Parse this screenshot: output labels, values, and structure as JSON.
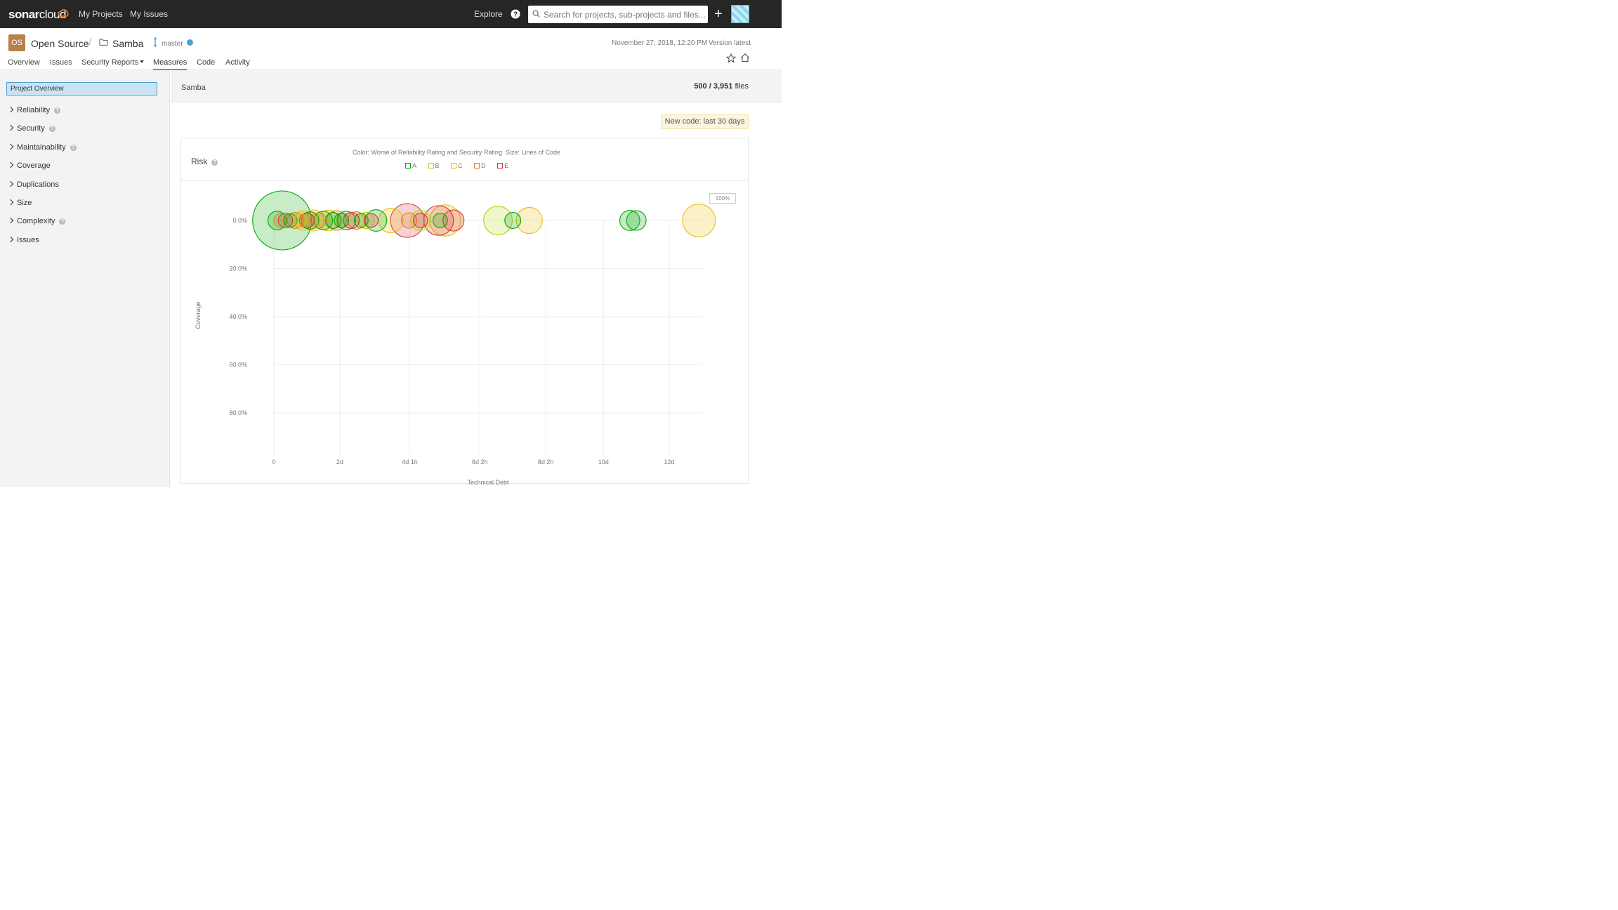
{
  "topbar": {
    "logo_text": "sonar",
    "logo_text_2": "cloud",
    "nav": [
      "My Projects",
      "My Issues"
    ],
    "explore": "Explore",
    "search_placeholder": "Search for projects, sub-projects and files...",
    "plus": "+"
  },
  "project": {
    "org_badge": "OS",
    "org_name": "Open Source",
    "name": "Samba",
    "branch": "master",
    "analysis_date": "November 27, 2018, 12:20 PM",
    "version": "Version latest",
    "tabs": [
      "Overview",
      "Issues",
      "Security Reports",
      "Measures",
      "Code",
      "Activity"
    ],
    "active_tab": "Measures"
  },
  "sidebar": {
    "overview": "Project Overview",
    "items": [
      {
        "label": "Reliability",
        "help": true
      },
      {
        "label": "Security",
        "help": true
      },
      {
        "label": "Maintainability",
        "help": true
      },
      {
        "label": "Coverage",
        "help": false
      },
      {
        "label": "Duplications",
        "help": false
      },
      {
        "label": "Size",
        "help": false
      },
      {
        "label": "Complexity",
        "help": true
      },
      {
        "label": "Issues",
        "help": false
      }
    ]
  },
  "main": {
    "component": "Samba",
    "files_shown": "500 / 3,951",
    "files_unit": "files",
    "new_code": "New code: last 30 days",
    "zoom": "100%"
  },
  "colors": {
    "A": "#00aa00",
    "B": "#b0d513",
    "C": "#eabe06",
    "D": "#ed7d20",
    "E": "#d4333f"
  },
  "chart_data": {
    "type": "scatter",
    "title": "Risk",
    "color_desc": "Color: Worse of Reliability Rating and Security Rating",
    "size_desc": "Size: Lines of Code",
    "legend": [
      "A",
      "B",
      "C",
      "D",
      "E"
    ],
    "xlabel": "Technical Debt",
    "ylabel": "Coverage",
    "x_unit": "days",
    "x_ticks": [
      {
        "value": 0,
        "label": "0"
      },
      {
        "value": 2,
        "label": "2d"
      },
      {
        "value": 4.125,
        "label": "4d 1h"
      },
      {
        "value": 6.25,
        "label": "6d 2h"
      },
      {
        "value": 8.25,
        "label": "8d 2h"
      },
      {
        "value": 10,
        "label": "10d"
      },
      {
        "value": 12,
        "label": "12d"
      }
    ],
    "xlim": [
      0,
      13
    ],
    "y_ticks": [
      0,
      20,
      40,
      60,
      80
    ],
    "y_tick_labels": [
      "0.0%",
      "20.0%",
      "40.0%",
      "60.0%",
      "80.0%"
    ],
    "ylim": [
      0,
      100
    ],
    "points": [
      {
        "x": 0.25,
        "y": 0,
        "size": 10,
        "rating": "A"
      },
      {
        "x": 0.1,
        "y": 0,
        "size": 2,
        "rating": "A"
      },
      {
        "x": 0.2,
        "y": 0,
        "size": 1,
        "rating": "D"
      },
      {
        "x": 0.35,
        "y": 0,
        "size": 1.2,
        "rating": "E"
      },
      {
        "x": 0.5,
        "y": 0,
        "size": 1,
        "rating": "A"
      },
      {
        "x": 0.65,
        "y": 0,
        "size": 1.5,
        "rating": "D"
      },
      {
        "x": 0.8,
        "y": 0,
        "size": 1,
        "rating": "C"
      },
      {
        "x": 0.9,
        "y": 0,
        "size": 2.2,
        "rating": "C"
      },
      {
        "x": 1.0,
        "y": 0,
        "size": 1.3,
        "rating": "E"
      },
      {
        "x": 1.1,
        "y": 0,
        "size": 1.8,
        "rating": "A"
      },
      {
        "x": 1.2,
        "y": 0,
        "size": 2.5,
        "rating": "C"
      },
      {
        "x": 1.35,
        "y": 0,
        "size": 1.4,
        "rating": "D"
      },
      {
        "x": 1.5,
        "y": 0,
        "size": 2,
        "rating": "A"
      },
      {
        "x": 1.65,
        "y": 0,
        "size": 2.4,
        "rating": "C"
      },
      {
        "x": 1.8,
        "y": 0,
        "size": 1.5,
        "rating": "A"
      },
      {
        "x": 1.9,
        "y": 0,
        "size": 2.2,
        "rating": "D"
      },
      {
        "x": 2.05,
        "y": 0,
        "size": 1.2,
        "rating": "A"
      },
      {
        "x": 2.2,
        "y": 0,
        "size": 2,
        "rating": "A"
      },
      {
        "x": 2.35,
        "y": 0,
        "size": 1.5,
        "rating": "E"
      },
      {
        "x": 2.5,
        "y": 0,
        "size": 1.8,
        "rating": "D"
      },
      {
        "x": 2.65,
        "y": 0,
        "size": 1.1,
        "rating": "A"
      },
      {
        "x": 2.8,
        "y": 0,
        "size": 1.6,
        "rating": "B"
      },
      {
        "x": 2.95,
        "y": 0,
        "size": 1.1,
        "rating": "E"
      },
      {
        "x": 3.1,
        "y": 0,
        "size": 2.6,
        "rating": "A"
      },
      {
        "x": 3.55,
        "y": 0,
        "size": 3.2,
        "rating": "C"
      },
      {
        "x": 4.05,
        "y": 0,
        "size": 5,
        "rating": "E"
      },
      {
        "x": 4.1,
        "y": 0,
        "size": 1.4,
        "rating": "D"
      },
      {
        "x": 4.45,
        "y": 0,
        "size": 2.3,
        "rating": "B"
      },
      {
        "x": 4.45,
        "y": 0,
        "size": 1.2,
        "rating": "E"
      },
      {
        "x": 5.0,
        "y": 0,
        "size": 4.2,
        "rating": "E"
      },
      {
        "x": 5.05,
        "y": 0,
        "size": 1.2,
        "rating": "A"
      },
      {
        "x": 5.2,
        "y": 0,
        "size": 4.5,
        "rating": "C"
      },
      {
        "x": 5.45,
        "y": 0,
        "size": 2.5,
        "rating": "E"
      },
      {
        "x": 6.8,
        "y": 0,
        "size": 4,
        "rating": "B"
      },
      {
        "x": 7.25,
        "y": 0,
        "size": 1.5,
        "rating": "A"
      },
      {
        "x": 7.75,
        "y": 0,
        "size": 3.5,
        "rating": "C"
      },
      {
        "x": 10.8,
        "y": 0,
        "size": 2.3,
        "rating": "A"
      },
      {
        "x": 11.0,
        "y": 0,
        "size": 2.2,
        "rating": "A"
      },
      {
        "x": 12.9,
        "y": 0,
        "size": 4.8,
        "rating": "C"
      }
    ]
  }
}
